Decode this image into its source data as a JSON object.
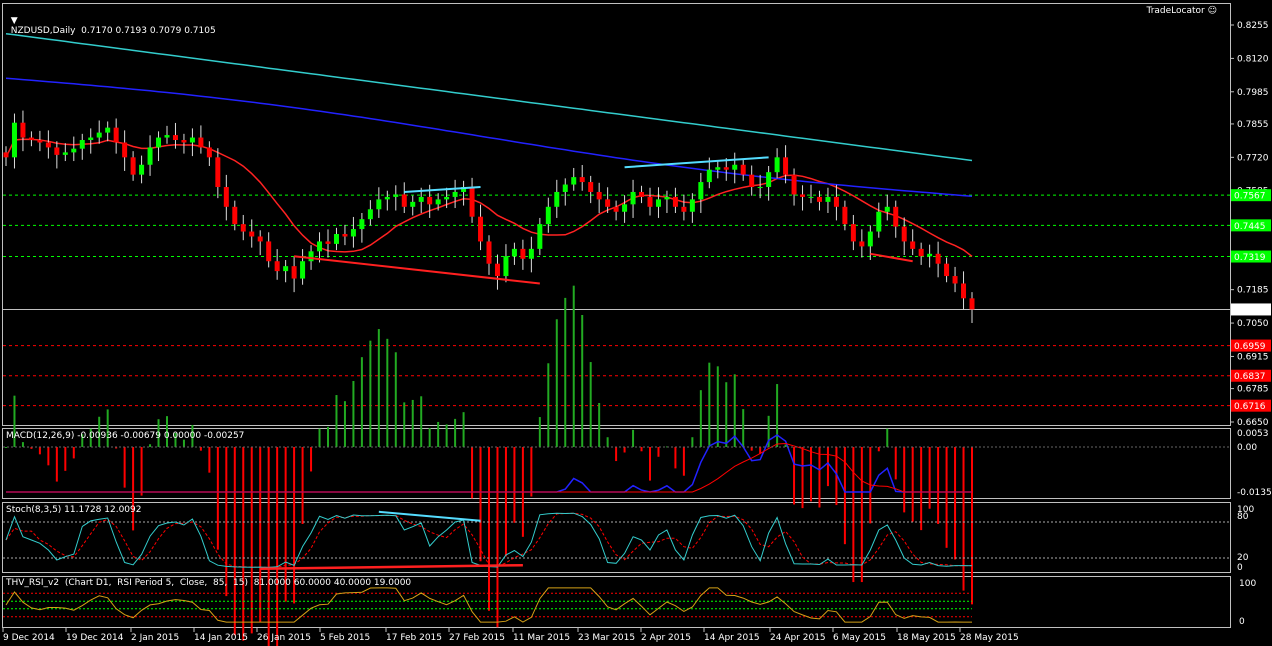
{
  "window": {
    "symbol_line": "NZDUSD,Daily  0.7170 0.7193 0.7079 0.7105",
    "broker": "TradeLocator"
  },
  "colors": {
    "bull": "#00ff00",
    "bear": "#ff0000",
    "ma_fast": "#ff2222",
    "ma_mid": "#2222ff",
    "ma_slow": "#33cccc",
    "trend_red": "#ff2020",
    "trend_cyan": "#55ddff",
    "grid": "#c0c0c0"
  },
  "chart_data": [
    {
      "type": "candlestick",
      "title": "NZDUSD,Daily",
      "ohlc_current": {
        "open": 0.717,
        "high": 0.7193,
        "low": 0.7079,
        "close": 0.7105
      },
      "ylim": [
        0.665,
        0.828
      ],
      "y_ticks": [
        "0.8255",
        "0.8120",
        "0.7985",
        "0.7855",
        "0.7720",
        "0.7585",
        "0.7445",
        "0.7319",
        "0.7185",
        "0.7105",
        "0.7050",
        "0.6959",
        "0.6915",
        "0.6837",
        "0.6785",
        "0.6716",
        "0.6650"
      ],
      "x_tick_labels": [
        "9 Dec 2014",
        "19 Dec 2014",
        "2 Jan 2015",
        "14 Jan 2015",
        "26 Jan 2015",
        "5 Feb 2015",
        "17 Feb 2015",
        "27 Feb 2015",
        "11 Mar 2015",
        "23 Mar 2015",
        "2 Apr 2015",
        "14 Apr 2015",
        "24 Apr 2015",
        "6 May 2015",
        "18 May 2015",
        "28 May 2015"
      ],
      "green_levels": [
        "0.7567",
        "0.7445",
        "0.7319"
      ],
      "red_levels": [
        "0.6959",
        "0.6837",
        "0.6716"
      ],
      "current_price": "0.7105",
      "closes": [
        0.772,
        0.786,
        0.78,
        0.779,
        0.778,
        0.776,
        0.773,
        0.774,
        0.7755,
        0.779,
        0.78,
        0.782,
        0.784,
        0.778,
        0.772,
        0.765,
        0.769,
        0.776,
        0.78,
        0.781,
        0.779,
        0.778,
        0.78,
        0.776,
        0.772,
        0.76,
        0.752,
        0.745,
        0.742,
        0.74,
        0.738,
        0.73,
        0.726,
        0.728,
        0.723,
        0.73,
        0.734,
        0.738,
        0.737,
        0.741,
        0.74,
        0.743,
        0.747,
        0.751,
        0.755,
        0.756,
        0.757,
        0.752,
        0.754,
        0.756,
        0.753,
        0.755,
        0.756,
        0.758,
        0.76,
        0.748,
        0.738,
        0.729,
        0.724,
        0.732,
        0.735,
        0.731,
        0.735,
        0.745,
        0.752,
        0.758,
        0.761,
        0.764,
        0.762,
        0.758,
        0.755,
        0.752,
        0.75,
        0.753,
        0.758,
        0.756,
        0.752,
        0.755,
        0.756,
        0.752,
        0.75,
        0.755,
        0.762,
        0.767,
        0.768,
        0.767,
        0.769,
        0.765,
        0.76,
        0.76,
        0.766,
        0.772,
        0.765,
        0.757,
        0.756,
        0.756,
        0.754,
        0.756,
        0.752,
        0.745,
        0.738,
        0.736,
        0.742,
        0.75,
        0.752,
        0.744,
        0.738,
        0.735,
        0.732,
        0.733,
        0.729,
        0.724,
        0.721,
        0.715,
        0.7105
      ],
      "moving_averages": [
        "fast MA (red)",
        "mid MA (blue)",
        "slow MA (cyan)"
      ]
    },
    {
      "type": "macd",
      "label": "MACD(12,26,9) -0.00936 -0.00679 0.00000 -0.00257",
      "y_ticks": [
        "0.0053",
        "0.00",
        "-0.01355"
      ]
    },
    {
      "type": "stochastic",
      "label": "Stoch(8,3,5) 11.1728 12.0092",
      "y_ticks": [
        "100",
        "80",
        "20",
        "0"
      ]
    },
    {
      "type": "rsi",
      "label": "THV_RSI_v2  (Chart D1,  RSI Period 5,  Close,  85,  15)  81.0000 60.0000 40.0000 19.0000",
      "y_ticks": [
        "100",
        "0"
      ]
    }
  ]
}
